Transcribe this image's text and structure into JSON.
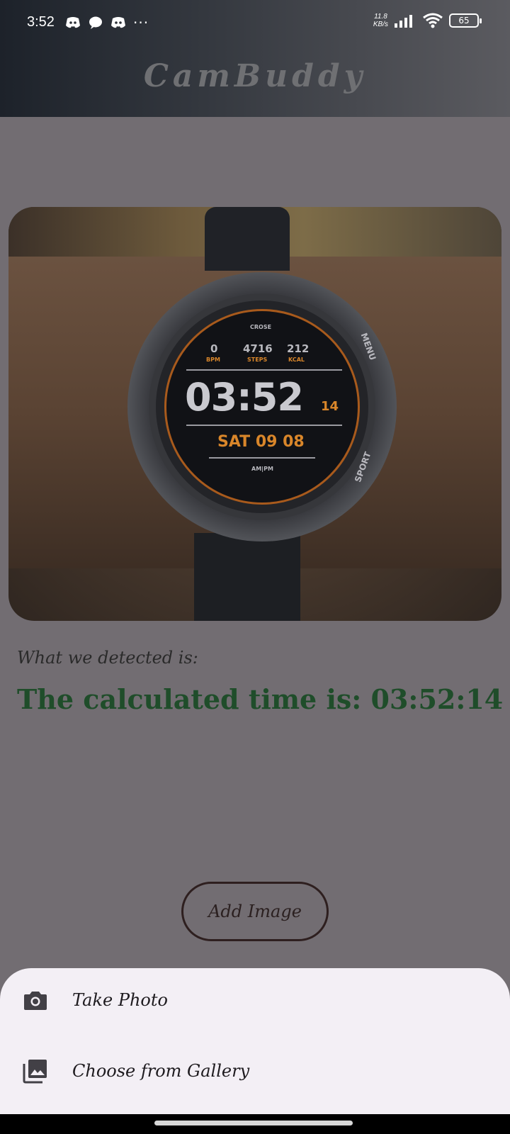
{
  "status_bar": {
    "time": "3:52",
    "network_speed_value": "11.8",
    "network_speed_unit": "KB/s",
    "battery": "65",
    "overflow": "···"
  },
  "app": {
    "title": "CamBuddy"
  },
  "watch_photo": {
    "watch_time_hm": "03:52",
    "watch_seconds": "14",
    "watch_date": "SAT 09 08",
    "bpm_value": "0",
    "bpm_label": "BPM",
    "steps_value": "4716",
    "steps_label": "STEPS",
    "kcal_value": "212",
    "kcal_label": "KCAL",
    "bezel_top_text": "CROSE",
    "bezel_bottom_text": "AM|PM",
    "side_text_right_top": "MENU",
    "side_text_right_bottom": "SPORT"
  },
  "detection": {
    "label": "What we detected is:",
    "result": "The calculated time is: 03:52:14"
  },
  "actions": {
    "add_image": "Add Image"
  },
  "bottom_sheet": {
    "items": [
      {
        "label": "Take Photo",
        "icon": "camera-icon"
      },
      {
        "label": "Choose from Gallery",
        "icon": "gallery-icon"
      }
    ]
  },
  "colors": {
    "result_text": "#1f4d2a",
    "sheet_bg": "#f3eff5",
    "scrim": "#726d72"
  }
}
